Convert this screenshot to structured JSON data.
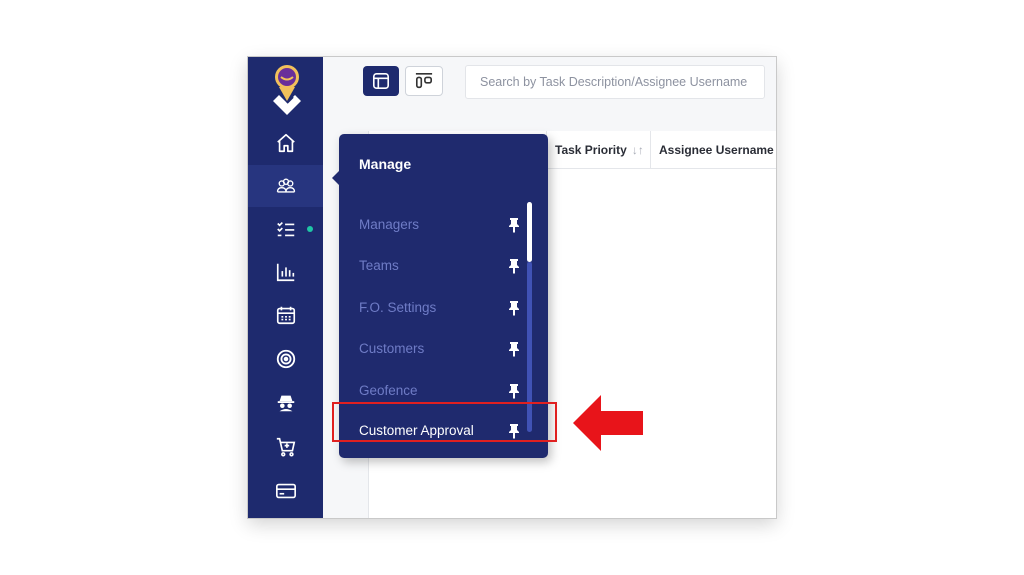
{
  "app": {
    "logo_icon": "location-pin-logo",
    "accent_color": "#1e2a6e"
  },
  "sidebar": {
    "items": [
      {
        "name": "home",
        "icon": "home-icon"
      },
      {
        "name": "manage",
        "icon": "team-icon",
        "active": true
      },
      {
        "name": "tasks",
        "icon": "task-list-icon",
        "status_dot_color": "#1fc6a5"
      },
      {
        "name": "reports",
        "icon": "bar-chart-icon"
      },
      {
        "name": "calendar",
        "icon": "calendar-icon"
      },
      {
        "name": "target",
        "icon": "target-icon"
      },
      {
        "name": "spy",
        "icon": "incognito-icon"
      },
      {
        "name": "cart",
        "icon": "cart-plus-icon"
      },
      {
        "name": "billing",
        "icon": "credit-card-icon"
      }
    ]
  },
  "toolbar": {
    "table_view_icon": "table-view-icon",
    "board_view_icon": "board-view-icon",
    "search_placeholder": "Search by Task Description/Assignee Username"
  },
  "grid": {
    "columns": [
      {
        "label": "Task Priority",
        "sort_icon": "sort-icon"
      },
      {
        "label": "Assignee Username",
        "sort_icon": "sort-icon"
      }
    ]
  },
  "menu": {
    "title": "Manage",
    "items": [
      {
        "label": "Managers",
        "pin_icon": "pin-icon"
      },
      {
        "label": "Teams",
        "pin_icon": "pin-icon"
      },
      {
        "label": "F.O. Settings",
        "pin_icon": "pin-icon"
      },
      {
        "label": "Customers",
        "pin_icon": "pin-icon"
      },
      {
        "label": "Geofence",
        "pin_icon": "pin-icon"
      },
      {
        "label": "Customer Approval",
        "pin_icon": "pin-icon",
        "highlighted": true
      }
    ]
  },
  "annotation": {
    "highlight_color": "#e02020",
    "arrow_icon": "left-arrow-icon"
  }
}
